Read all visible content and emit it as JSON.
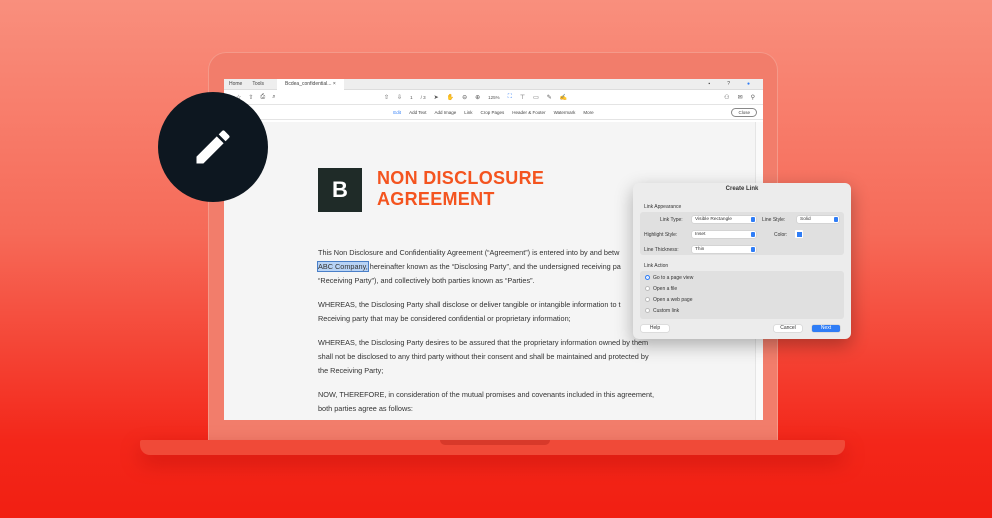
{
  "tabs": {
    "home": "Home",
    "tools": "Tools",
    "doc": "Bcdea_confidential...",
    "close": "×"
  },
  "toolbar": {
    "page": "1",
    "page_total": "/ 3",
    "zoom": "125%"
  },
  "editbar": {
    "items": [
      "Edit",
      "Add Text",
      "Add Image",
      "Link",
      "Crop Pages",
      "Header & Footer",
      "Watermark",
      "More"
    ],
    "close": "Close"
  },
  "document": {
    "logo": "B",
    "title_line1": "NON DISCLOSURE",
    "title_line2": "AGREEMENT",
    "p1": [
      "This Non Disclosure and Confidentiality Agreement (“Agreement”) is entered into by and betw",
      "hereinafter known as the “Disclosing Party”, and the undersigned receiving pa",
      "“Receiving Party”), and collectively both parties known as “Parties”."
    ],
    "highlight": "ABC Company,",
    "p2": [
      "WHEREAS, the Disclosing Party shall disclose or deliver tangible or intangible information to t",
      "Receiving party that may be considered confidential or proprietary information;"
    ],
    "p3": [
      "WHEREAS, the Disclosing Party desires to be assured that the proprietary information owned by them",
      "shall not be disclosed to any third party without their consent and shall be maintained and protected by",
      "the Receiving Party;"
    ],
    "p4": [
      "NOW, THEREFORE, in consideration of the mutual promises and covenants included in this agreement,",
      "both parties agree as follows:"
    ]
  },
  "dialog": {
    "title": "Create Link",
    "appearance": "Link Appearance",
    "link_type_label": "Link Type:",
    "link_type": "Visible Rectangle",
    "line_style_label": "Line Style:",
    "line_style": "Solid",
    "highlight_label": "Highlight Style:",
    "highlight": "Inset",
    "color_label": "Color:",
    "color": "#2f7df6",
    "thickness_label": "Line Thickness:",
    "thickness": "Thin",
    "action": "Link Action",
    "options": [
      "Go to a page view",
      "Open a file",
      "Open a web page",
      "Custom link"
    ],
    "help": "Help",
    "cancel": "Cancel",
    "next": "Next"
  },
  "colors": {
    "accent": "#f4541f",
    "primary": "#2f7df6"
  }
}
